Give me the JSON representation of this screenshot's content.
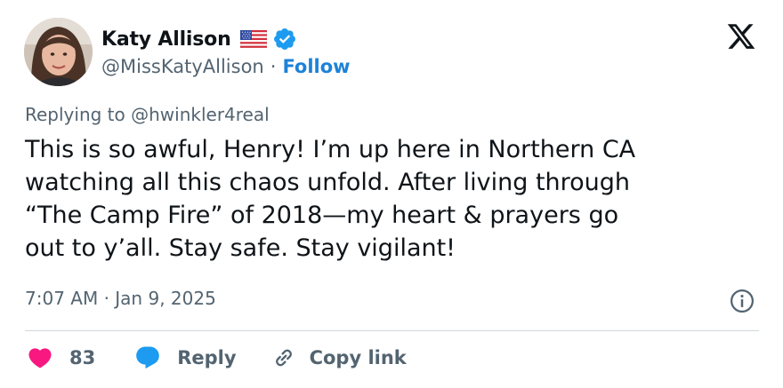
{
  "author": {
    "display_name": "Katy Allison",
    "handle": "@MissKatyAllison",
    "separator": "·",
    "follow_label": "Follow"
  },
  "tweet": {
    "replying_to": "Replying to @hwinkler4real",
    "text": "This is so awful, Henry! I’m up here in Northern CA\nwatching all this chaos unfold. After living through\n“The Camp Fire” of 2018—my heart & prayers go\nout to y’all. Stay safe. Stay vigilant!",
    "timestamp": "7:07 AM · Jan 9, 2025"
  },
  "actions": {
    "like_count": "83",
    "reply_label": "Reply",
    "copy_link_label": "Copy link"
  },
  "colors": {
    "like": "#f91880",
    "reply": "#1d9bf0",
    "verified": "#1d9bf0",
    "follow": "#1d82d8",
    "secondary_text": "#536471"
  }
}
